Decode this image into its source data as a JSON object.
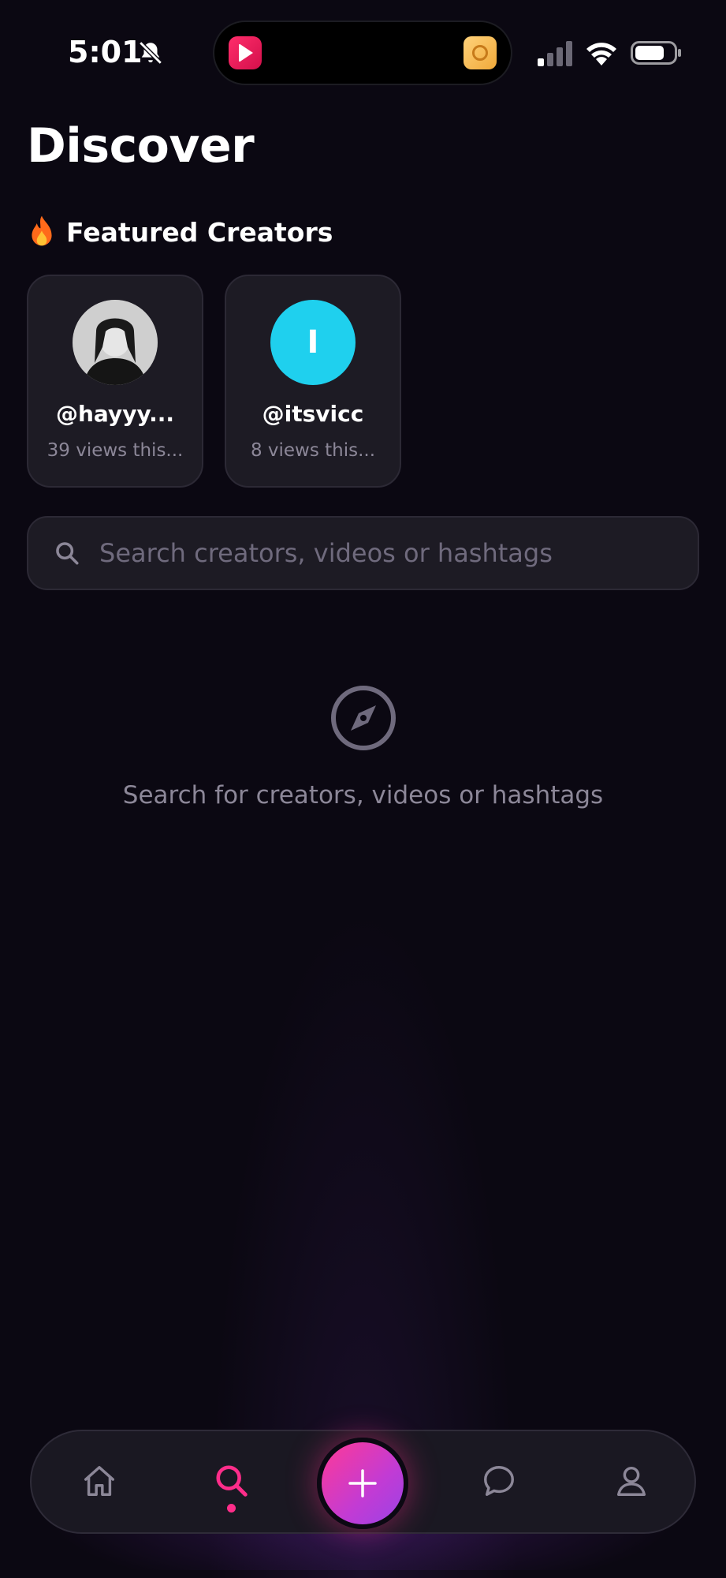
{
  "status_bar": {
    "time": "5:01"
  },
  "page": {
    "title": "Discover"
  },
  "featured": {
    "heading": "Featured Creators",
    "creators": [
      {
        "handle": "@hayyy...",
        "views": "39 views this...",
        "avatar": "photo"
      },
      {
        "handle": "@itsvicc",
        "views": "8 views this...",
        "avatar_letter": "I",
        "avatar_color": "#1fd0ee"
      }
    ]
  },
  "search": {
    "placeholder": "Search creators, videos or hashtags",
    "value": ""
  },
  "empty_state": {
    "icon": "compass-icon",
    "message": "Search for creators, videos or hashtags"
  },
  "bottom_nav": {
    "items": [
      {
        "name": "home",
        "icon": "home-icon"
      },
      {
        "name": "search",
        "icon": "search-icon",
        "active": true
      },
      {
        "name": "create",
        "icon": "plus-icon"
      },
      {
        "name": "messages",
        "icon": "chat-icon"
      },
      {
        "name": "profile",
        "icon": "user-icon"
      }
    ],
    "accent_color": "#ff2d8a"
  },
  "colors": {
    "background": "#0b0812",
    "card": "#1d1b24",
    "muted_text": "#8c8798",
    "accent": "#ff2d8a"
  }
}
